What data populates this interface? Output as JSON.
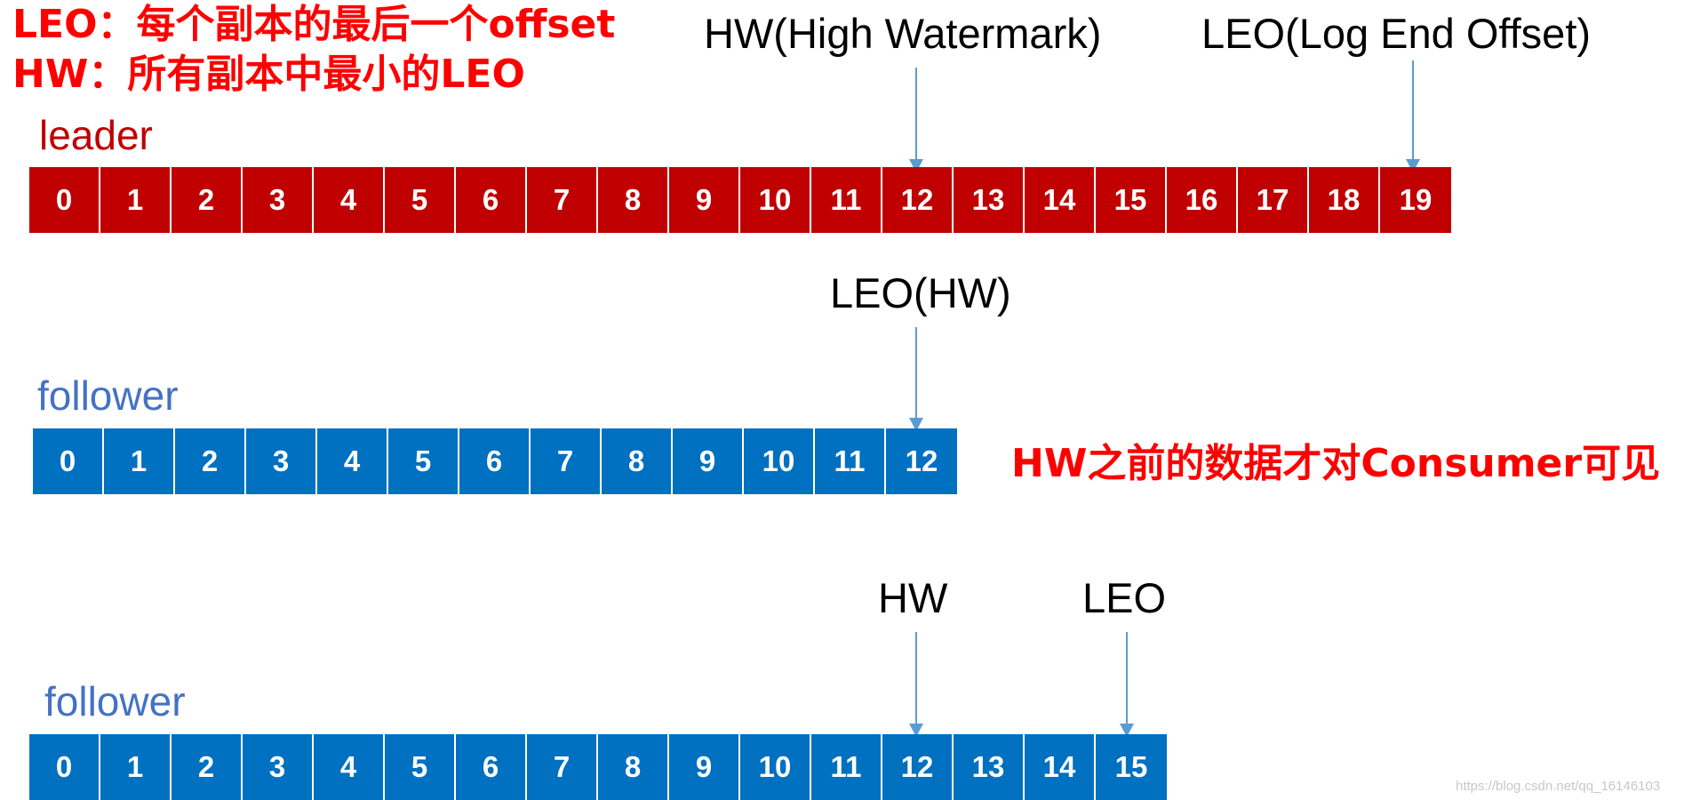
{
  "notes": {
    "leo_definition": "LEO：每个副本的最后一个offset",
    "hw_definition": "HW：所有副本中最小的LEO",
    "visibility": "HW之前的数据才对Consumer可见"
  },
  "colors": {
    "leader": "#c00000",
    "follower": "#0070c0",
    "follower_label": "#4472c4",
    "arrow": "#5b9bd5",
    "note": "#ff0000"
  },
  "leader": {
    "label": "leader",
    "cells": [
      "0",
      "1",
      "2",
      "3",
      "4",
      "5",
      "6",
      "7",
      "8",
      "9",
      "10",
      "11",
      "12",
      "13",
      "14",
      "15",
      "16",
      "17",
      "18",
      "19"
    ],
    "markers": [
      {
        "label": "HW(High Watermark)",
        "offset": 12
      },
      {
        "label": "LEO(Log End Offset)",
        "offset": 19
      }
    ]
  },
  "follower1": {
    "label": "follower",
    "cells": [
      "0",
      "1",
      "2",
      "3",
      "4",
      "5",
      "6",
      "7",
      "8",
      "9",
      "10",
      "11",
      "12"
    ],
    "markers": [
      {
        "label": "LEO(HW)",
        "offset": 12
      }
    ]
  },
  "follower2": {
    "label": "follower",
    "cells": [
      "0",
      "1",
      "2",
      "3",
      "4",
      "5",
      "6",
      "7",
      "8",
      "9",
      "10",
      "11",
      "12",
      "13",
      "14",
      "15"
    ],
    "markers": [
      {
        "label": "HW",
        "offset": 12
      },
      {
        "label": "LEO",
        "offset": 15
      }
    ]
  },
  "watermark": "https://blog.csdn.net/qq_16146103"
}
